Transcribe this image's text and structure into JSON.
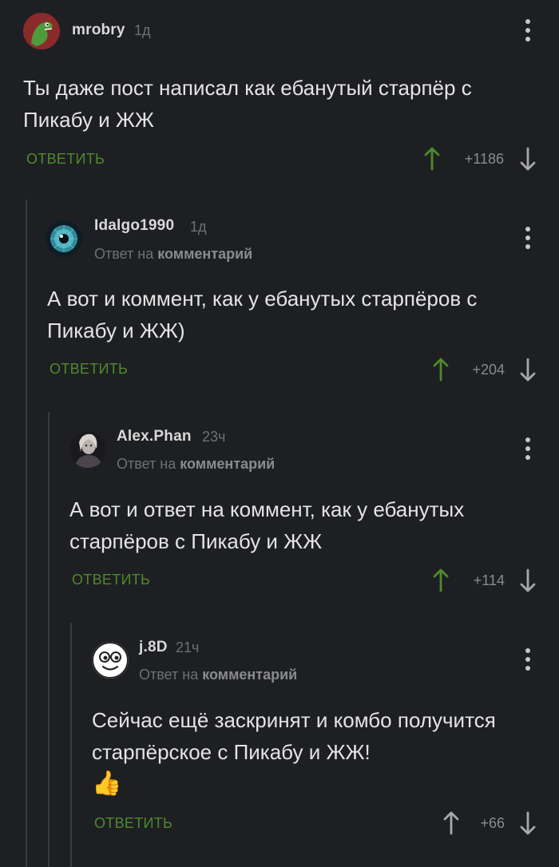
{
  "comments": [
    {
      "username": "mrobry",
      "time": "1д",
      "reply_prefix": "",
      "reply_target": "",
      "text": "Ты даже пост написал как ебанутый старпёр с Пикабу и ЖЖ",
      "reply_label": "ОТВЕТИТЬ",
      "rating": "+1186",
      "avatar": "dinosaur-avatar"
    },
    {
      "username": "Idalgo1990",
      "time": "1д",
      "reply_prefix": "Ответ на",
      "reply_target": "комментарий",
      "text": "А вот и коммент, как у ебанутых старпёров с Пикабу и ЖЖ)",
      "reply_label": "ОТВЕТИТЬ",
      "rating": "+204",
      "avatar": "eye-avatar"
    },
    {
      "username": "Alex.Phan",
      "time": "23ч",
      "reply_prefix": "Ответ на",
      "reply_target": "комментарий",
      "text": "А вот и ответ на коммент, как у ебанутых старпёров с Пикабу и ЖЖ",
      "reply_label": "ОТВЕТИТЬ",
      "rating": "+114",
      "avatar": "portrait-avatar"
    },
    {
      "username": "j.8D",
      "time": "21ч",
      "reply_prefix": "Ответ на",
      "reply_target": "комментарий",
      "text": "Сейчас ещё заскринят и комбо получится старпёрское с Пикабу и ЖЖ!",
      "emoji": "👍",
      "reply_label": "ОТВЕТИТЬ",
      "rating": "+66",
      "avatar": "smiley-avatar"
    }
  ],
  "colors": {
    "background": "#1e1f22",
    "reply_green": "#4e8a2c",
    "upvote_green": "#4e8a2c",
    "muted": "#6f7074"
  }
}
